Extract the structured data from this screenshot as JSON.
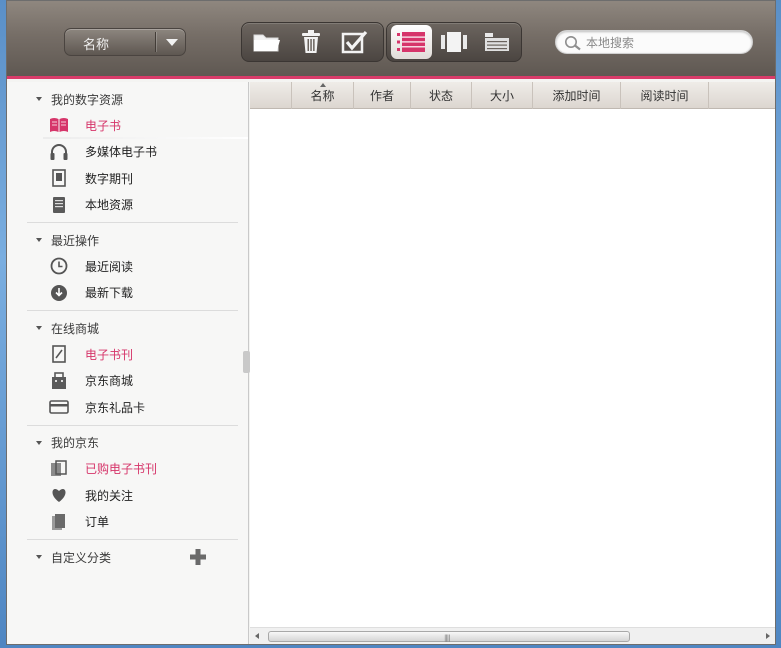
{
  "toolbar": {
    "sort_select": {
      "label": "名称"
    },
    "buttons": [
      {
        "name": "open-folder",
        "icon": "folder-icon"
      },
      {
        "name": "delete",
        "icon": "trash-icon"
      },
      {
        "name": "select",
        "icon": "checkbox-icon"
      }
    ],
    "view_buttons": [
      {
        "name": "list-view",
        "icon": "list-view-icon",
        "active": true
      },
      {
        "name": "cover-view",
        "icon": "cover-view-icon",
        "active": false
      },
      {
        "name": "shelf-view",
        "icon": "shelf-view-icon",
        "active": false
      }
    ],
    "search": {
      "placeholder": "本地搜索",
      "value": ""
    }
  },
  "sidebar": {
    "sections": [
      {
        "title": "我的数字资源",
        "items": [
          {
            "label": "电子书",
            "icon": "book-icon",
            "active": true
          },
          {
            "label": "多媒体电子书",
            "icon": "headphones-icon"
          },
          {
            "label": "数字期刊",
            "icon": "magazine-icon"
          },
          {
            "label": "本地资源",
            "icon": "local-file-icon"
          }
        ]
      },
      {
        "title": "最近操作",
        "items": [
          {
            "label": "最近阅读",
            "icon": "clock-icon"
          },
          {
            "label": "最新下载",
            "icon": "download-icon"
          }
        ]
      },
      {
        "title": "在线商城",
        "items": [
          {
            "label": "电子书刊",
            "icon": "ebook-store-icon",
            "highlight": true
          },
          {
            "label": "京东商城",
            "icon": "store-icon"
          },
          {
            "label": "京东礼品卡",
            "icon": "gift-card-icon"
          }
        ]
      },
      {
        "title": "我的京东",
        "items": [
          {
            "label": "已购电子书刊",
            "icon": "purchased-icon",
            "highlight": true
          },
          {
            "label": "我的关注",
            "icon": "heart-icon"
          },
          {
            "label": "订单",
            "icon": "order-icon"
          }
        ]
      },
      {
        "title": "自定义分类",
        "items": []
      }
    ]
  },
  "table": {
    "columns": [
      "名称",
      "作者",
      "状态",
      "大小",
      "添加时间",
      "阅读时间"
    ],
    "rows": []
  },
  "colors": {
    "accent": "#d6356a",
    "toolbar": "#766e67"
  }
}
